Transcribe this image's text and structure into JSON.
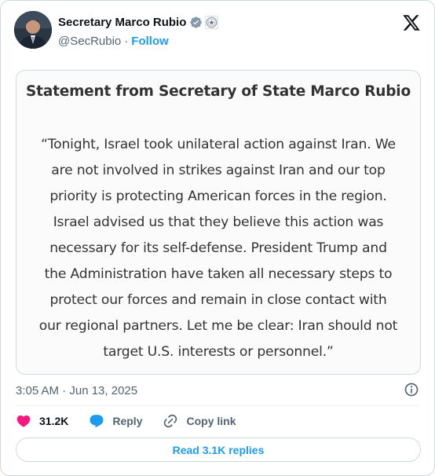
{
  "author": {
    "name": "Secretary Marco Rubio",
    "handle": "@SecRubio",
    "separator": "·",
    "follow_label": "Follow"
  },
  "statement": {
    "title": "Statement from Secretary of State Marco Rubio",
    "body": "“Tonight, Israel took unilateral action against Iran. We are not involved in strikes against Iran and our top priority is protecting American forces in the region. Israel advised us that they believe this action was necessary for its self-defense. President Trump and the Administration have taken all necessary steps to protect our forces and remain in close contact with our regional partners. Let me be clear: Iran should not target U.S. interests or personnel.”"
  },
  "meta": {
    "timestamp": "3:05 AM · Jun 13, 2025"
  },
  "actions": {
    "likes": "31.2K",
    "reply_label": "Reply",
    "copy_label": "Copy link"
  },
  "read_replies_label": "Read 3.1K replies",
  "colors": {
    "accent": "#1d9bf0",
    "like": "#f91880",
    "verified": "#829aab",
    "muted": "#536471"
  }
}
